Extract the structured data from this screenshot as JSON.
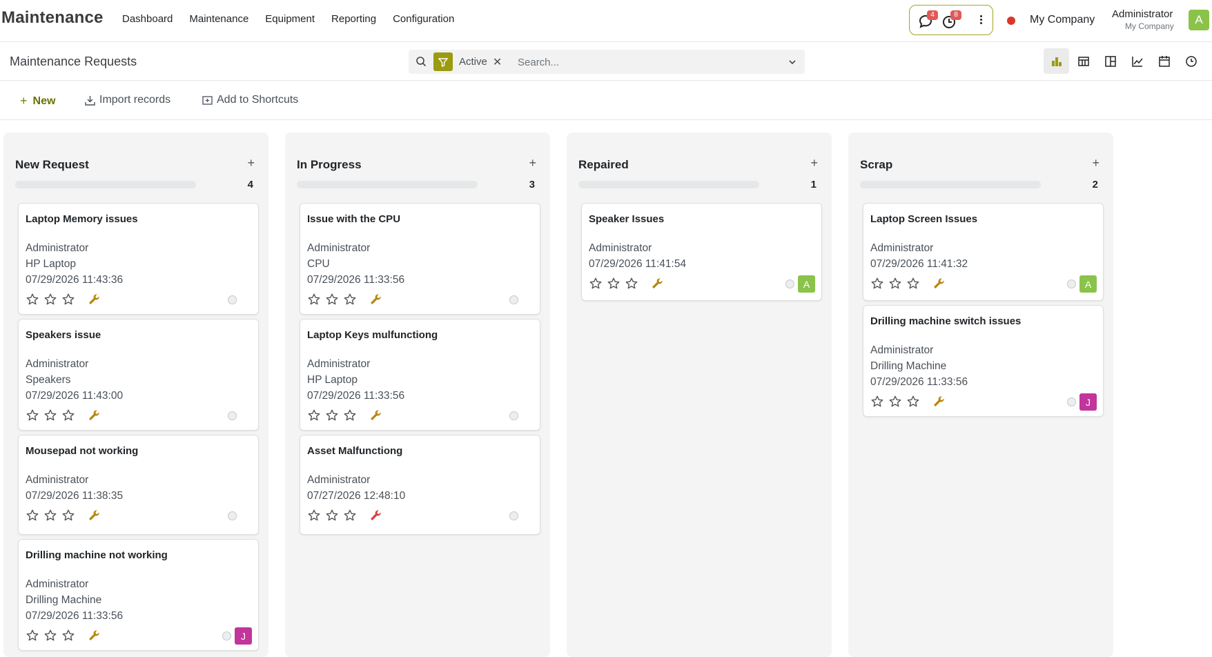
{
  "app": {
    "brand": "Maintenance"
  },
  "nav": {
    "items": [
      {
        "label": "Dashboard"
      },
      {
        "label": "Maintenance"
      },
      {
        "label": "Equipment"
      },
      {
        "label": "Reporting"
      },
      {
        "label": "Configuration"
      }
    ],
    "messages_count": "4",
    "activities_count": "8",
    "company": "My Company",
    "user_name": "Administrator",
    "user_company": "My Company",
    "user_initial": "A",
    "status_color": "#d9372c"
  },
  "control_panel": {
    "title": "Maintenance Requests",
    "facet_label": "Active",
    "search_placeholder": "Search...",
    "views": [
      "kanban-view-icon",
      "list-view-icon",
      "pivot-view-icon",
      "graph-view-icon",
      "calendar-view-icon",
      "activity-view-icon"
    ],
    "active_view": "kanban"
  },
  "actions": {
    "new_label": "New",
    "import_label": "Import records",
    "shortcuts_label": "Add to Shortcuts"
  },
  "colors": {
    "accent": "#9b9b12",
    "wrench": "#b8860b",
    "wrench_alert": "#e03a3a",
    "avatar_a": "#8bc34a",
    "avatar_j": "#c2359b"
  },
  "columns": [
    {
      "title": "New Request",
      "count": "4",
      "cards": [
        {
          "title": "Laptop Memory issues",
          "lines": [
            "Administrator",
            "HP Laptop",
            "07/29/2026 11:43:36"
          ],
          "avatar": ""
        },
        {
          "title": "Speakers issue",
          "lines": [
            "Administrator",
            "Speakers",
            "07/29/2026 11:43:00"
          ],
          "avatar": ""
        },
        {
          "title": "Mousepad not working",
          "lines": [
            "Administrator",
            "07/29/2026 11:38:35"
          ],
          "avatar": ""
        },
        {
          "title": "Drilling machine not working",
          "lines": [
            "Administrator",
            "Drilling Machine",
            "07/29/2026 11:33:56"
          ],
          "avatar": "J"
        }
      ]
    },
    {
      "title": "In Progress",
      "count": "3",
      "cards": [
        {
          "title": "Issue with the CPU",
          "lines": [
            "Administrator",
            "CPU",
            "07/29/2026 11:33:56"
          ],
          "avatar": ""
        },
        {
          "title": "Laptop Keys mulfunctiong",
          "lines": [
            "Administrator",
            "HP Laptop",
            "07/29/2026 11:33:56"
          ],
          "avatar": ""
        },
        {
          "title": "Asset Malfunctiong",
          "lines": [
            "Administrator",
            "07/27/2026 12:48:10"
          ],
          "avatar": ""
        }
      ]
    },
    {
      "title": "Repaired",
      "count": "1",
      "cards": [
        {
          "title": "Speaker Issues",
          "lines": [
            "Administrator",
            "07/29/2026 11:41:54"
          ],
          "avatar": "A"
        }
      ]
    },
    {
      "title": "Scrap",
      "count": "2",
      "cards": [
        {
          "title": "Laptop Screen Issues",
          "lines": [
            "Administrator",
            "07/29/2026 11:41:32"
          ],
          "avatar": "A"
        },
        {
          "title": "Drilling machine switch issues",
          "lines": [
            "Administrator",
            "Drilling Machine",
            "07/29/2026 11:33:56"
          ],
          "avatar": "J"
        }
      ]
    }
  ]
}
